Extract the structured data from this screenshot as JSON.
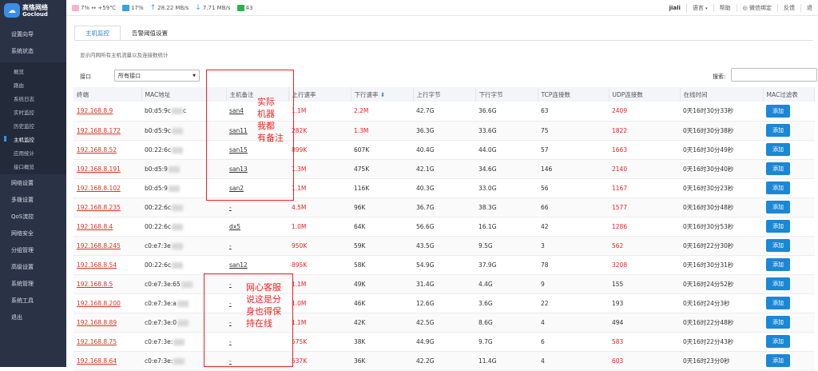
{
  "brand": {
    "name_cn": "高恪网络",
    "name_en": "Gocloud"
  },
  "sidebar": {
    "items": [
      {
        "label": "设置向导"
      },
      {
        "label": "系统状态"
      }
    ],
    "sub": [
      {
        "label": "概览"
      },
      {
        "label": "路由"
      },
      {
        "label": "系统日志"
      },
      {
        "label": "实时监控"
      },
      {
        "label": "历史监控"
      },
      {
        "label": "主机监控"
      },
      {
        "label": "应用统计"
      },
      {
        "label": "接口概览"
      }
    ],
    "items2": [
      {
        "label": "网络设置"
      },
      {
        "label": "多拨设置"
      },
      {
        "label": "QoS流控"
      },
      {
        "label": "网络安全"
      },
      {
        "label": "分组管理"
      },
      {
        "label": "高级设置"
      },
      {
        "label": "系统管理"
      },
      {
        "label": "系统工具"
      },
      {
        "label": "退出"
      }
    ]
  },
  "topbar": {
    "cpu": "7% ↔ +59℃",
    "mem": "17%",
    "up": "28.22 MB/s",
    "down": "7.71 MB/s",
    "count": "43",
    "user": "jiali",
    "lang": "语言",
    "help": "帮助",
    "wechat": "微信绑定",
    "feedback": "反馈",
    "logout": "退"
  },
  "tabs": {
    "t1": "主机监控",
    "t2": "告警阈值设置"
  },
  "desc": "显示内网所有主机流量以及连接数统计",
  "filter": {
    "label": "接口",
    "value": "所有接口",
    "search_label": "搜索:"
  },
  "table": {
    "headers": [
      "终端",
      "MAC地址",
      "主机备注",
      "上行速率",
      "下行速率",
      "上行字节",
      "下行字节",
      "TCP连接数",
      "UDP连接数",
      "在线时间",
      "MAC过滤表"
    ],
    "sort_icon": "⬍",
    "rows": [
      {
        "ip": "192.168.8.9",
        "mac": "b0:d5:9c",
        "mac2": "c",
        "note": "san4",
        "up": "1.1M",
        "down": "2.2M",
        "ub": "42.7G",
        "db": "36.6G",
        "tcp": "63",
        "udp": "2409",
        "time": "0天16时30分33秒",
        "btn": "添加"
      },
      {
        "ip": "192.168.8.172",
        "mac": "b0:d5:9c",
        "mac2": "",
        "note": "san11",
        "up": "282K",
        "down": "1.3M",
        "ub": "36.3G",
        "db": "33.6G",
        "tcp": "75",
        "udp": "1822",
        "time": "0天16时30分38秒",
        "btn": "添加"
      },
      {
        "ip": "192.168.8.52",
        "mac": "00:22:6c",
        "mac2": "",
        "note": "san15",
        "up": "899K",
        "down": "607K",
        "ub": "40.4G",
        "db": "44.0G",
        "tcp": "57",
        "udp": "1663",
        "time": "0天16时30分49秒",
        "btn": "添加"
      },
      {
        "ip": "192.168.8.191",
        "mac": "b0:d5:9",
        "mac2": "",
        "note": "san13",
        "up": "1.3M",
        "down": "475K",
        "ub": "42.1G",
        "db": "34.6G",
        "tcp": "146",
        "udp": "2140",
        "time": "0天16时30分40秒",
        "btn": "添加"
      },
      {
        "ip": "192.168.8.102",
        "mac": "b0:d5:9",
        "mac2": "",
        "note": "san2",
        "up": "1.1M",
        "down": "116K",
        "ub": "40.3G",
        "db": "33.0G",
        "tcp": "56",
        "udp": "1167",
        "time": "0天16时30分23秒",
        "btn": "添加"
      },
      {
        "ip": "192.168.8.235",
        "mac": "00:22:6c",
        "mac2": "",
        "note": "-",
        "up": "4.5M",
        "down": "96K",
        "ub": "36.7G",
        "db": "38.3G",
        "tcp": "66",
        "udp": "1577",
        "time": "0天16时30分48秒",
        "btn": "添加"
      },
      {
        "ip": "192.168.8.4",
        "mac": "00:22:6c",
        "mac2": "",
        "note": "dx5",
        "up": "1.0M",
        "down": "64K",
        "ub": "56.6G",
        "db": "16.1G",
        "tcp": "42",
        "udp": "1286",
        "time": "0天16时30分53秒",
        "btn": "添加"
      },
      {
        "ip": "192.168.8.245",
        "mac": "c0:e7:3e",
        "mac2": "",
        "note": "-",
        "up": "950K",
        "down": "59K",
        "ub": "43.5G",
        "db": "9.5G",
        "tcp": "3",
        "udp": "562",
        "time": "0天16时22分30秒",
        "btn": "添加"
      },
      {
        "ip": "192.168.8.54",
        "mac": "00:22:6c",
        "mac2": "",
        "note": "san12",
        "up": "895K",
        "down": "58K",
        "ub": "54.9G",
        "db": "37.9G",
        "tcp": "78",
        "udp": "3208",
        "time": "0天16时30分31秒",
        "btn": "添加"
      },
      {
        "ip": "192.168.8.5",
        "mac": "c0:e7:3e:65",
        "mac2": "",
        "note": "-",
        "up": "1.1M",
        "down": "49K",
        "ub": "31.4G",
        "db": "4.4G",
        "tcp": "9",
        "udp": "155",
        "time": "0天16时24分52秒",
        "btn": "添加"
      },
      {
        "ip": "192.168.8.200",
        "mac": "c0:e7:3e:a",
        "mac2": "",
        "note": "-",
        "up": "1.0M",
        "down": "46K",
        "ub": "12.6G",
        "db": "3.6G",
        "tcp": "22",
        "udp": "193",
        "time": "0天16时24分3秒",
        "btn": "添加"
      },
      {
        "ip": "192.168.8.89",
        "mac": "c0:e7:3e:0",
        "mac2": "",
        "note": "-",
        "up": "1.1M",
        "down": "42K",
        "ub": "42.5G",
        "db": "8.6G",
        "tcp": "4",
        "udp": "494",
        "time": "0天16时22分48秒",
        "btn": "添加"
      },
      {
        "ip": "192.168.8.75",
        "mac": "c0:e7:3e:",
        "mac2": "",
        "note": "-",
        "up": "575K",
        "down": "38K",
        "ub": "44.9G",
        "db": "9.7G",
        "tcp": "6",
        "udp": "583",
        "time": "0天16时22分43秒",
        "btn": "添加"
      },
      {
        "ip": "192.168.8.64",
        "mac": "c0:e7:3e:",
        "mac2": "",
        "note": "-",
        "up": "537K",
        "down": "36K",
        "ub": "42.2G",
        "db": "11.4G",
        "tcp": "4",
        "udp": "603",
        "time": "0天16时23分0秒",
        "btn": "添加"
      }
    ]
  },
  "annotations": {
    "a1": [
      "实际",
      "机器",
      "我都",
      "有备注"
    ],
    "a2": [
      "网心客服",
      "说这是分",
      "身也得保",
      "持在线"
    ]
  }
}
